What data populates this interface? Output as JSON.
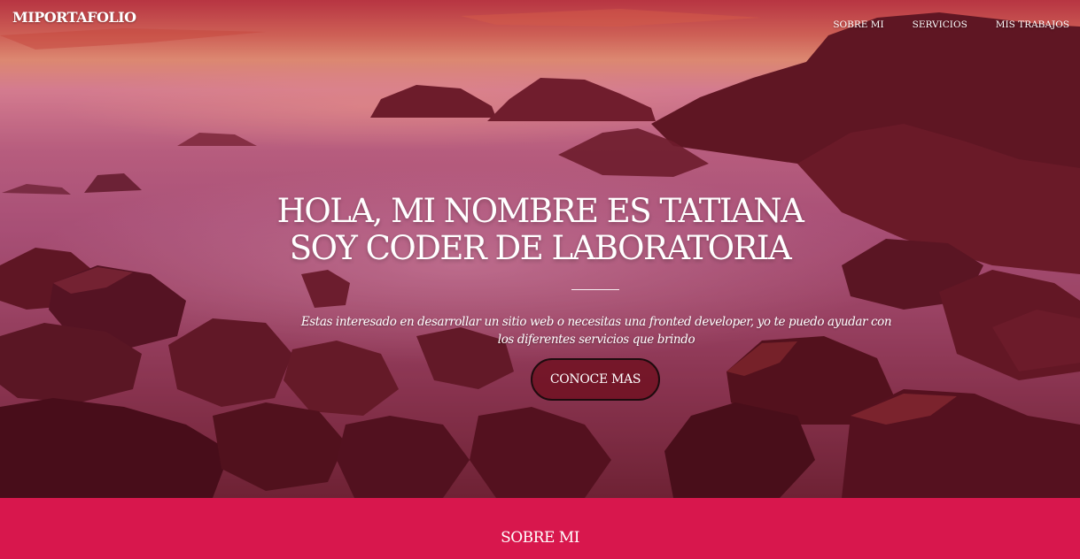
{
  "header": {
    "brand": "MIPORTAFOLIO",
    "nav": [
      "SOBRE MI",
      "SERVICIOS",
      "MIS TRABAJOS"
    ]
  },
  "hero": {
    "headline_line1": "HOLA, MI NOMBRE ES TATIANA",
    "headline_line2": "SOY CODER DE LABORATORIA",
    "lede": "Estas interesado en desarrollar un sitio web o necesitas una fronted developer, yo te puedo ayudar con los diferentes servicios que brindo",
    "cta_label": "CONOCE MAS"
  },
  "about": {
    "title": "SOBRE MI"
  },
  "colors": {
    "about_band": "#d8174d",
    "cta_fill": "#6e0e1e"
  }
}
